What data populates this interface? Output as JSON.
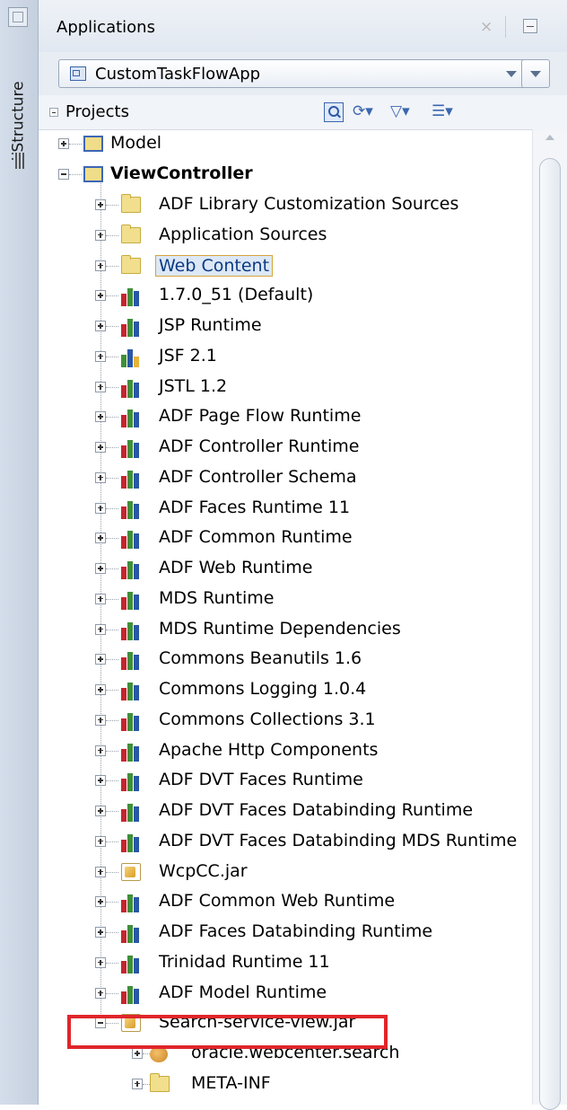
{
  "side_panel": {
    "tab_label": "Structure"
  },
  "header": {
    "title": "Applications",
    "close_glyph": "×"
  },
  "app_selector": {
    "value": "CustomTaskFlowApp"
  },
  "projects_bar": {
    "label": "Projects",
    "toolbar": {
      "search_icon": "search-icon",
      "sync_glyph": "⟳▾",
      "filter_glyph": "▽▾",
      "tree_glyph": "☰▾"
    }
  },
  "tree": {
    "model": "Model",
    "viewcontroller": "ViewController",
    "children": [
      {
        "label": "ADF Library Customization Sources",
        "icon": "folder-icon"
      },
      {
        "label": "Application Sources",
        "icon": "folder-icon"
      },
      {
        "label": "Web Content",
        "icon": "folder-icon",
        "selected": true
      },
      {
        "label": "1.7.0_51 (Default)",
        "icon": "library-icon"
      },
      {
        "label": "JSP Runtime",
        "icon": "library-icon"
      },
      {
        "label": "JSF 2.1",
        "icon": "jsf-library-icon"
      },
      {
        "label": "JSTL 1.2",
        "icon": "library-icon"
      },
      {
        "label": "ADF Page Flow Runtime",
        "icon": "library-icon"
      },
      {
        "label": "ADF Controller Runtime",
        "icon": "library-icon"
      },
      {
        "label": "ADF Controller Schema",
        "icon": "library-icon"
      },
      {
        "label": "ADF Faces Runtime 11",
        "icon": "library-icon"
      },
      {
        "label": "ADF Common Runtime",
        "icon": "library-icon"
      },
      {
        "label": "ADF Web Runtime",
        "icon": "library-icon"
      },
      {
        "label": "MDS Runtime",
        "icon": "library-icon"
      },
      {
        "label": "MDS Runtime Dependencies",
        "icon": "library-icon"
      },
      {
        "label": "Commons Beanutils 1.6",
        "icon": "library-icon"
      },
      {
        "label": "Commons Logging 1.0.4",
        "icon": "library-icon"
      },
      {
        "label": "Commons Collections 3.1",
        "icon": "library-icon"
      },
      {
        "label": "Apache Http Components",
        "icon": "library-icon"
      },
      {
        "label": "ADF DVT Faces Runtime",
        "icon": "library-icon"
      },
      {
        "label": "ADF DVT Faces Databinding Runtime",
        "icon": "library-icon"
      },
      {
        "label": "ADF DVT Faces Databinding MDS Runtime",
        "icon": "library-icon"
      },
      {
        "label": "WcpCC.jar",
        "icon": "jar-icon"
      },
      {
        "label": "ADF Common Web Runtime",
        "icon": "library-icon"
      },
      {
        "label": "ADF Faces Databinding Runtime",
        "icon": "library-icon"
      },
      {
        "label": "Trinidad Runtime 11",
        "icon": "library-icon"
      },
      {
        "label": "ADF Model Runtime",
        "icon": "library-icon"
      },
      {
        "label": "Search-service-view.jar",
        "icon": "jar-icon",
        "expanded": true,
        "highlighted": true
      }
    ],
    "jar_children": [
      {
        "label": "oracle.webcenter.search",
        "icon": "package-icon"
      },
      {
        "label": "META-INF",
        "icon": "folder-icon"
      }
    ]
  },
  "colors": {
    "highlight_box": "#e0262b",
    "selection_border": "#d6a43c",
    "panel_header": "#e2e8f1",
    "library_red": "#c2272d",
    "library_green": "#3f8f3a",
    "library_blue": "#2a57a6"
  }
}
